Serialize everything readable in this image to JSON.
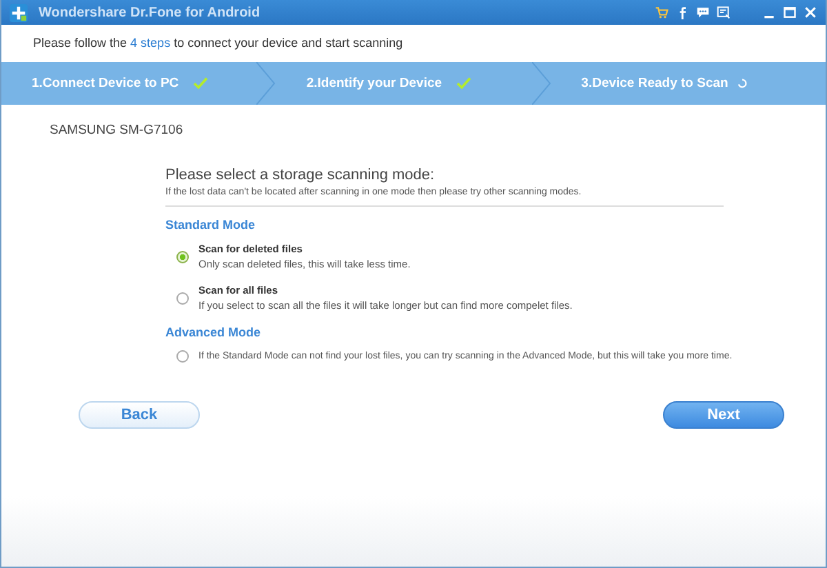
{
  "window": {
    "title": "Wondershare Dr.Fone for Android"
  },
  "instruction": {
    "before": "Please follow the ",
    "link": "4 steps",
    "after": " to connect your device and start scanning"
  },
  "steps": [
    {
      "label": "1.Connect Device to PC",
      "completed": true
    },
    {
      "label": "2.Identify your Device",
      "completed": true
    },
    {
      "label": "3.Device Ready to Scan",
      "completed": false
    }
  ],
  "device": "SAMSUNG SM-G7106",
  "prompt": {
    "title": "Please select a storage scanning mode:",
    "note": "If the lost data can't be located after scanning in one mode then please try other scanning modes."
  },
  "sections": [
    {
      "heading": "Standard Mode",
      "options": [
        {
          "title": "Scan for deleted files",
          "description": "Only scan deleted files, this will take less time.",
          "selected": true
        },
        {
          "title": "Scan for all files",
          "description": "If you select to scan all the files it will take longer but can find more compelet files.",
          "selected": false
        }
      ]
    },
    {
      "heading": "Advanced Mode",
      "options": [
        {
          "description": "If the Standard Mode can not find your lost files, you can try scanning in the Advanced Mode, but this will take you more time.",
          "selected": false
        }
      ]
    }
  ],
  "buttons": {
    "back": "Back",
    "next": "Next"
  }
}
